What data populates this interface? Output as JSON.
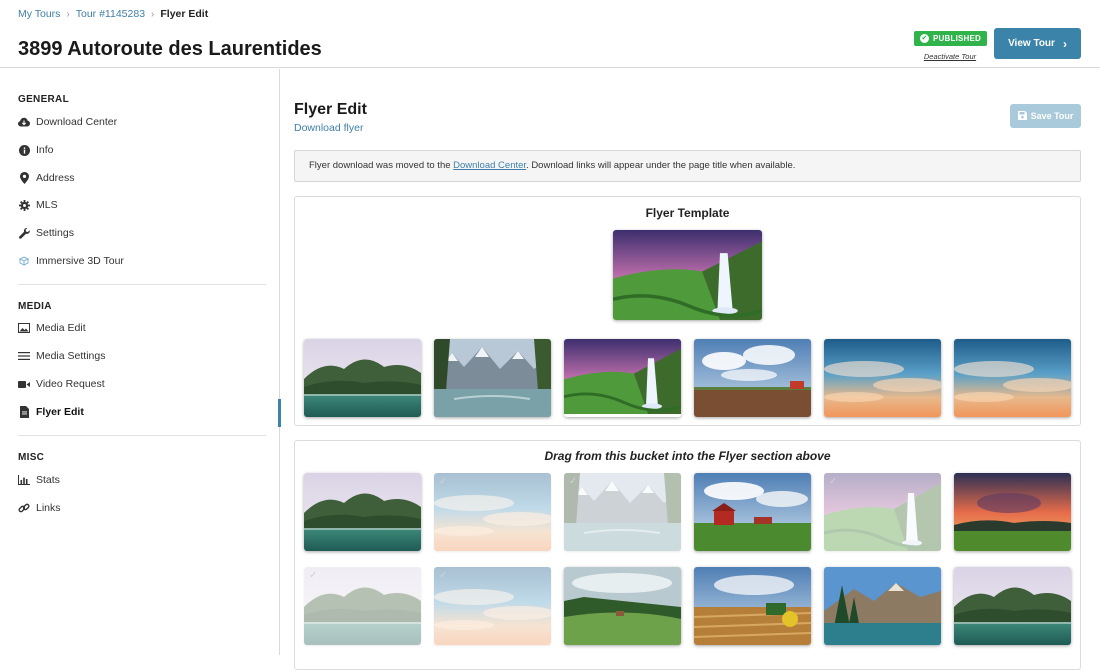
{
  "breadcrumb": {
    "items": [
      "My Tours",
      "Tour #1145283"
    ],
    "current": "Flyer Edit"
  },
  "header": {
    "title": "3899 Autoroute des Laurentides",
    "status_badge": "PUBLISHED",
    "deactivate_link": "Deactivate Tour",
    "view_tour_label": "View Tour"
  },
  "sidebar": {
    "general_title": "GENERAL",
    "general_items": [
      {
        "label": "Download Center",
        "icon": "cloud-download-icon"
      },
      {
        "label": "Info",
        "icon": "info-icon"
      },
      {
        "label": "Address",
        "icon": "map-pin-icon"
      },
      {
        "label": "MLS",
        "icon": "gear-icon"
      },
      {
        "label": "Settings",
        "icon": "wrench-icon"
      },
      {
        "label": "Immersive 3D Tour",
        "icon": "3d-tour-icon"
      }
    ],
    "media_title": "MEDIA",
    "media_items": [
      {
        "label": "Media Edit",
        "icon": "image-icon"
      },
      {
        "label": "Media Settings",
        "icon": "sliders-icon"
      },
      {
        "label": "Video Request",
        "icon": "video-camera-icon"
      },
      {
        "label": "Flyer Edit",
        "icon": "file-icon",
        "active": true
      }
    ],
    "misc_title": "MISC",
    "misc_items": [
      {
        "label": "Stats",
        "icon": "bar-chart-icon"
      },
      {
        "label": "Links",
        "icon": "link-icon"
      }
    ]
  },
  "main": {
    "title": "Flyer Edit",
    "download_link": "Download flyer",
    "save_label": "Save Tour",
    "notice_before": "Flyer download was moved to the ",
    "notice_link": "Download Center",
    "notice_after": ". Download links will appear under the page title when available.",
    "template_title": "Flyer Template",
    "bucket_title": "Drag from this bucket into the Flyer section above"
  },
  "colors": {
    "accent": "#3b83a9",
    "published": "#2fb34a",
    "link": "#3f7fa8"
  }
}
